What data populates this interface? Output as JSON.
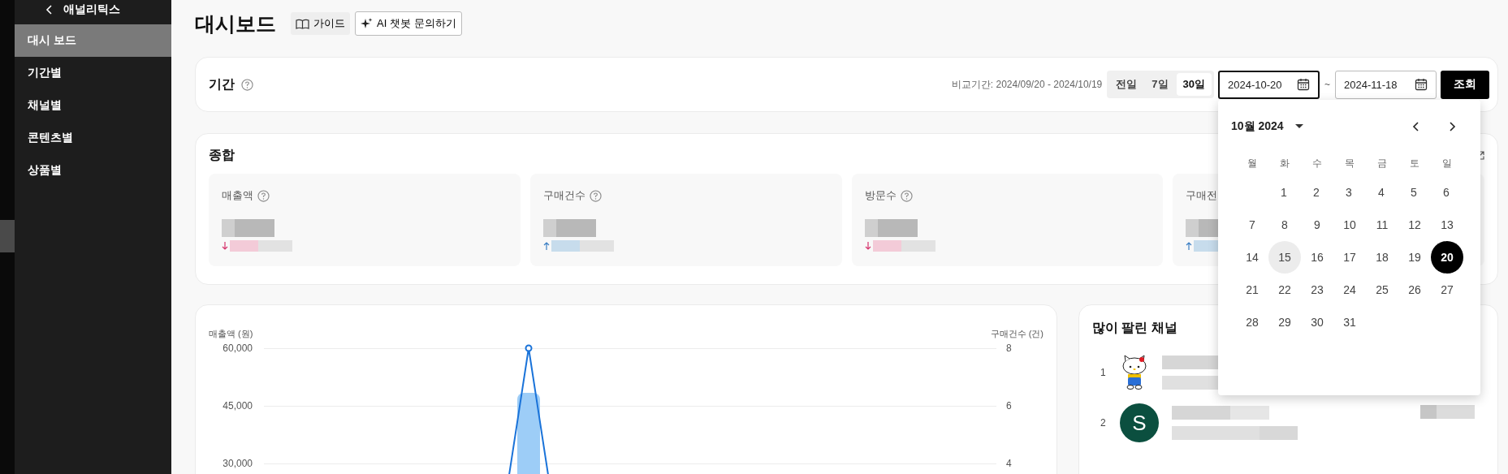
{
  "sidebar": {
    "back_label": "애널리틱스",
    "items": [
      {
        "label": "대시 보드",
        "selected": true
      },
      {
        "label": "기간별",
        "selected": false
      },
      {
        "label": "채널별",
        "selected": false
      },
      {
        "label": "콘텐츠별",
        "selected": false
      },
      {
        "label": "상품별",
        "selected": false
      }
    ]
  },
  "header": {
    "title": "대시보드",
    "guide_button": "가이드",
    "ai_button": "AI 챗봇 문의하기"
  },
  "period": {
    "title": "기간",
    "compare_text": "비교기간: 2024/09/20 - 2024/10/19",
    "presets": [
      {
        "label": "전일",
        "selected": false
      },
      {
        "label": "7일",
        "selected": false
      },
      {
        "label": "30일",
        "selected": true
      }
    ],
    "start_date": "2024-10-20",
    "separator": "~",
    "end_date": "2024-11-18",
    "submit": "조회",
    "calendar": {
      "month_label": "10월 2024",
      "weekdays": [
        "월",
        "화",
        "수",
        "목",
        "금",
        "토",
        "일"
      ],
      "weeks": [
        [
          {
            "label": "1",
            "selected": false,
            "highlighted": false
          },
          {
            "label": "2",
            "selected": false,
            "highlighted": false
          },
          {
            "label": "3",
            "selected": false,
            "highlighted": false
          },
          {
            "label": "4",
            "selected": false,
            "highlighted": false
          },
          {
            "label": "5",
            "selected": false,
            "highlighted": false
          },
          {
            "label": "6",
            "selected": false,
            "highlighted": false
          }
        ],
        [
          {
            "label": "7",
            "selected": false,
            "highlighted": false
          },
          {
            "label": "8",
            "selected": false,
            "highlighted": false
          },
          {
            "label": "9",
            "selected": false,
            "highlighted": false
          },
          {
            "label": "10",
            "selected": false,
            "highlighted": false
          },
          {
            "label": "11",
            "selected": false,
            "highlighted": false
          },
          {
            "label": "12",
            "selected": false,
            "highlighted": false
          },
          {
            "label": "13",
            "selected": false,
            "highlighted": false
          }
        ],
        [
          {
            "label": "14",
            "selected": false,
            "highlighted": false
          },
          {
            "label": "15",
            "selected": false,
            "highlighted": true
          },
          {
            "label": "16",
            "selected": false,
            "highlighted": false
          },
          {
            "label": "17",
            "selected": false,
            "highlighted": false
          },
          {
            "label": "18",
            "selected": false,
            "highlighted": false
          },
          {
            "label": "19",
            "selected": false,
            "highlighted": false
          },
          {
            "label": "20",
            "selected": true,
            "highlighted": false
          }
        ],
        [
          {
            "label": "21",
            "selected": false,
            "highlighted": false
          },
          {
            "label": "22",
            "selected": false,
            "highlighted": false
          },
          {
            "label": "23",
            "selected": false,
            "highlighted": false
          },
          {
            "label": "24",
            "selected": false,
            "highlighted": false
          },
          {
            "label": "25",
            "selected": false,
            "highlighted": false
          },
          {
            "label": "26",
            "selected": false,
            "highlighted": false
          },
          {
            "label": "27",
            "selected": false,
            "highlighted": false
          }
        ],
        [
          {
            "label": "28",
            "selected": false,
            "highlighted": false
          },
          {
            "label": "29",
            "selected": false,
            "highlighted": false
          },
          {
            "label": "30",
            "selected": false,
            "highlighted": false
          },
          {
            "label": "31",
            "selected": false,
            "highlighted": false
          }
        ]
      ]
    }
  },
  "summary": {
    "title": "종합",
    "metrics": [
      {
        "label": "매출액",
        "help": true,
        "decrease": true
      },
      {
        "label": "구매건수",
        "help": true,
        "decrease": false
      },
      {
        "label": "방문수",
        "help": true,
        "decrease": true
      },
      {
        "label": "구매전",
        "help": false,
        "decrease": false
      }
    ]
  },
  "sales_chart": {
    "left_axis_title": "매출액 (원)",
    "right_axis_title": "구매건수 (건)",
    "left_ticks": [
      "60,000",
      "45,000",
      "30,000"
    ],
    "right_ticks": [
      "8",
      "6",
      "4"
    ]
  },
  "top_channels": {
    "title": "많이 팔린 채널",
    "rows": [
      {
        "rank": "1",
        "kind": "image",
        "extra": false
      },
      {
        "rank": "2",
        "kind": "letter",
        "letter": "S",
        "color": "#0b4f3f",
        "extra": true
      }
    ]
  }
}
